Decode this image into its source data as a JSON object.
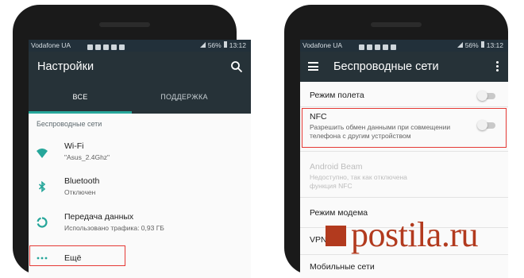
{
  "left_phone": {
    "status": {
      "carrier": "Vodafone UA",
      "battery": "56%",
      "time": "13:12"
    },
    "appbar": {
      "title": "Настройки",
      "icon": "search-icon"
    },
    "tabs": [
      {
        "label": "ВСЕ",
        "active": true
      },
      {
        "label": "ПОДДЕРЖКА",
        "active": false
      }
    ],
    "section_title": "Беспроводные сети",
    "items": [
      {
        "label": "Wi-Fi",
        "sub": "\"Asus_2.4Ghz\"",
        "icon": "wifi-icon"
      },
      {
        "label": "Bluetooth",
        "sub": "Отключен",
        "icon": "bluetooth-icon"
      },
      {
        "label": "Передача данных",
        "sub": "Использовано трафика: 0,93 ГБ",
        "icon": "data-usage-icon"
      },
      {
        "label": "Ещё",
        "sub": "",
        "icon": "more-dots-icon"
      }
    ]
  },
  "right_phone": {
    "status": {
      "carrier": "Vodafone UA",
      "battery": "56%",
      "time": "13:12"
    },
    "appbar": {
      "title": "Беспроводные сети",
      "menu_icon": "hamburger-icon",
      "overflow_icon": "overflow-icon"
    },
    "rows": [
      {
        "label": "Режим полета",
        "sub": "",
        "toggle": false,
        "disabled": false
      },
      {
        "label": "NFC",
        "sub": "Разрешить обмен данными при совмещении телефона с другим устройством",
        "toggle": false,
        "disabled": false
      },
      {
        "label": "Android Beam",
        "sub": "Недоступно, так как отключена функция NFC",
        "disabled": true
      },
      {
        "label": "Режим модема",
        "sub": "",
        "disabled": false
      },
      {
        "label": "VPN",
        "sub": "",
        "disabled": false
      },
      {
        "label": "Мобильные сети",
        "sub": "",
        "disabled": false
      }
    ]
  },
  "watermark": {
    "text": "postila.ru"
  },
  "colors": {
    "appbar": "#263238",
    "accent": "#26a69a",
    "highlight": "#e53935"
  }
}
